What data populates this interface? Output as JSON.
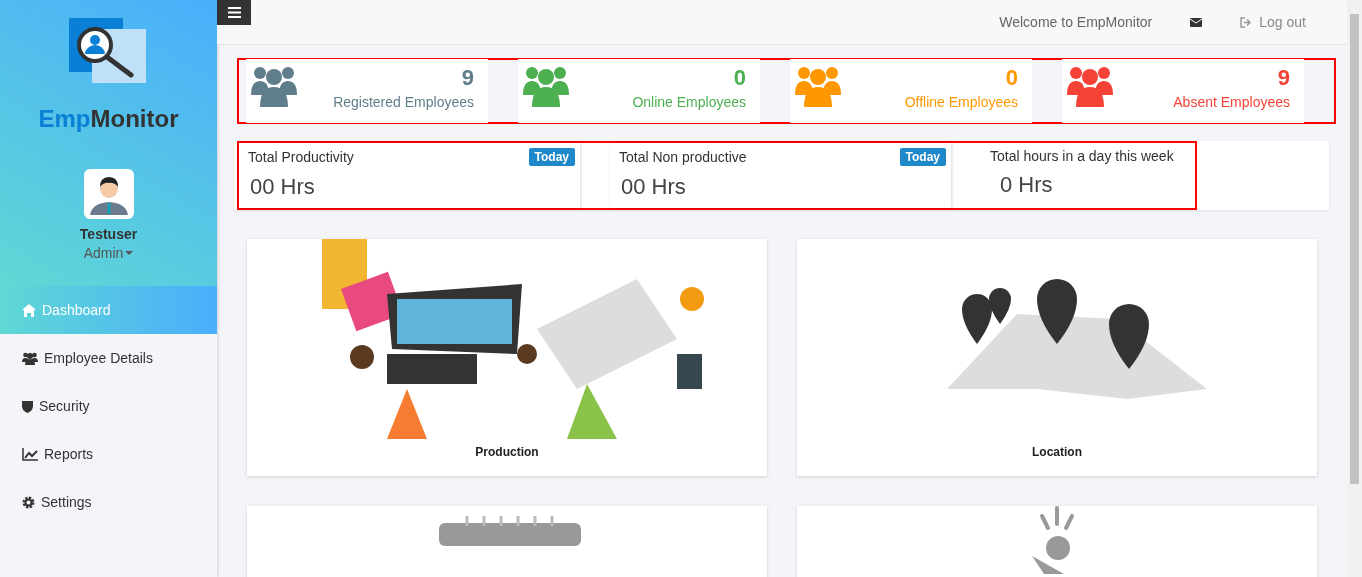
{
  "sidebar": {
    "logo": {
      "part_1": "Emp",
      "part_2": "Monitor"
    },
    "user": {
      "name": "Testuser",
      "role": "Admin"
    },
    "items": [
      {
        "label": "Dashboard",
        "kind": "home",
        "selected": true
      },
      {
        "label": "Employee Details",
        "kind": "users",
        "selected": false
      },
      {
        "label": "Security",
        "kind": "shield",
        "selected": false
      },
      {
        "label": "Reports",
        "kind": "chart",
        "selected": false
      },
      {
        "label": "Settings",
        "kind": "gear",
        "selected": false
      }
    ]
  },
  "header": {
    "welcome": "Welcome to EmpMonitor",
    "logout": "Log out"
  },
  "stats": [
    {
      "count": "9",
      "label": "Registered Employees",
      "color": "#607d8b"
    },
    {
      "count": "0",
      "label": "Online Employees",
      "color": "#4caf50"
    },
    {
      "count": "0",
      "label": "Offline Employees",
      "color": "#ff9800"
    },
    {
      "count": "9",
      "label": "Absent Employees",
      "color": "#f44336"
    }
  ],
  "hours": [
    {
      "title": "Total Productivity",
      "badge": "Today",
      "value": "00 Hrs"
    },
    {
      "title": "Total Non productive",
      "badge": "Today",
      "value": "00 Hrs"
    },
    {
      "title": "Total hours in a day this week",
      "value": "0 Hrs"
    }
  ],
  "tiles": [
    {
      "label": "Production",
      "kind": "desk"
    },
    {
      "label": "Location",
      "kind": "map"
    },
    {
      "kind": "calendar"
    },
    {
      "kind": "person"
    }
  ]
}
